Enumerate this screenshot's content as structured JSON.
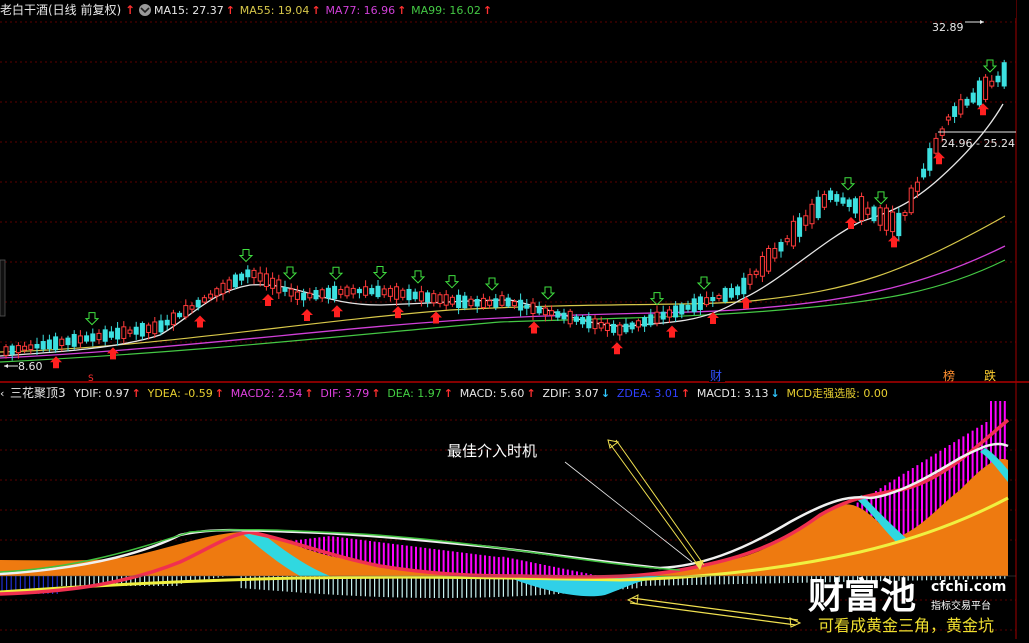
{
  "top_header": {
    "title": "老白干酒(日线 前复权)",
    "ma_items": [
      {
        "label": "MA15: 27.37",
        "color": "#e8e8e8"
      },
      {
        "label": "MA55: 19.04",
        "color": "#d8c84a"
      },
      {
        "label": "MA77: 16.96",
        "color": "#d040d8"
      },
      {
        "label": "MA99: 16.02",
        "color": "#44c844"
      }
    ]
  },
  "price_panel": {
    "high_label": "32.89",
    "mid_label": "24.96 - 25.24",
    "low_label": "8.60",
    "marker_s": "S",
    "marker_cai": "财",
    "marker_bang": "榜",
    "marker_die": "跌"
  },
  "indicator_header": {
    "name": "三花聚顶3",
    "items": [
      {
        "label": "YDIF: 0.97",
        "color": "#e8e8e8",
        "arrow": "↑",
        "arrow_color": "#ff3030"
      },
      {
        "label": "YDEA: -0.59",
        "color": "#e8d030",
        "arrow": "↑",
        "arrow_color": "#ff3030"
      },
      {
        "label": "MACD2: 2.54",
        "color": "#e040e0",
        "arrow": "↑",
        "arrow_color": "#ff3030"
      },
      {
        "label": "DIF: 3.79",
        "color": "#e040e0",
        "arrow": "↑",
        "arrow_color": "#ff3030"
      },
      {
        "label": "DEA: 1.97",
        "color": "#44d044",
        "arrow": "↑",
        "arrow_color": "#ff3030"
      },
      {
        "label": "MACD: 5.60",
        "color": "#e8e8e8",
        "arrow": "↑",
        "arrow_color": "#ff3030"
      },
      {
        "label": "ZDIF: 3.07",
        "color": "#e8e8e8",
        "arrow": "↓",
        "arrow_color": "#30c8ff"
      },
      {
        "label": "ZDEA: 3.01",
        "color": "#3040ff",
        "arrow": "↑",
        "arrow_color": "#ff3030"
      },
      {
        "label": "MACD1: 3.13",
        "color": "#e8e8e8",
        "arrow": "↓",
        "arrow_color": "#30c8ff"
      },
      {
        "label": "MCD走强选股: 0.00",
        "color": "#e8d030",
        "arrow": "",
        "arrow_color": "#e8d030"
      }
    ]
  },
  "annotations": {
    "best_entry": "最佳介入时机",
    "golden_note": "可看成黄金三角，黄金坑"
  },
  "watermark": {
    "brand": "财富池",
    "domain": "cfchi.com",
    "subtitle": "指标交易平台"
  },
  "colors": {
    "up": "#ff3b3b",
    "down": "#3ce0e0",
    "grid": "#7a0000"
  }
}
